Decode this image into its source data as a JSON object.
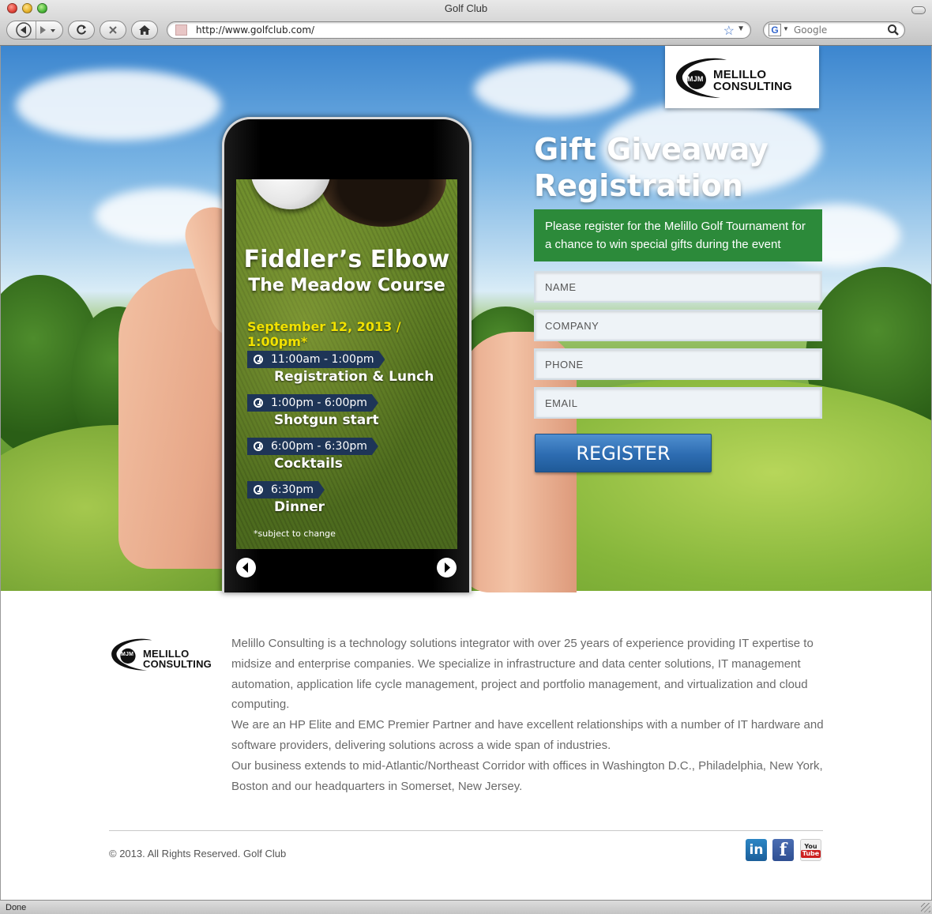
{
  "window": {
    "title": "Golf Club"
  },
  "toolbar": {
    "url": "http://www.golfclub.com/",
    "search_placeholder": "Google",
    "search_engine_letter": "G"
  },
  "phone_screen": {
    "title": "Fiddler’s Elbow",
    "subtitle": "The Meadow Course",
    "date": "September 12, 2013 / 1:00pm*",
    "schedule": [
      {
        "time": "11:00am - 1:00pm",
        "label": "Registration & Lunch"
      },
      {
        "time": "1:00pm - 6:00pm",
        "label": "Shotgun start"
      },
      {
        "time": "6:00pm - 6:30pm",
        "label": "Cocktails"
      },
      {
        "time": "6:30pm",
        "label": "Dinner"
      }
    ],
    "note": "*subject to change"
  },
  "logo": {
    "line1": "MELILLO",
    "line2": "CONSULTING",
    "mark": "MJM"
  },
  "registration": {
    "heading_line1": "Gift Giveaway",
    "heading_line2": "Registration",
    "intro": "Please register for the Melillo Golf Tournament for a chance to win special gifts during the event",
    "name_placeholder": "NAME",
    "company_placeholder": "COMPANY",
    "phone_placeholder": "PHONE",
    "email_placeholder": "EMAIL",
    "register_label": "REGISTER"
  },
  "about": {
    "paragraph1": "Melillo Consulting is a technology solutions integrator with over 25 years of experience providing IT expertise to midsize and enterprise companies. We specialize in infrastructure and data center solutions, IT management automation, application life cycle management, project and portfolio management, and virtualization and cloud computing.",
    "paragraph2": "We are an HP Elite and EMC Premier Partner and have excellent relationships with a number of IT hardware and software providers, delivering solutions across a wide span of industries.",
    "paragraph3": "Our business extends to mid-Atlantic/Northeast Corridor with offices in Washington D.C., Philadelphia, New York, Boston and our headquarters in Somerset, New Jersey."
  },
  "footer": {
    "copyright": "© 2013. All Rights Reserved. Golf Club",
    "linkedin_label": "in",
    "facebook_label": "f",
    "youtube_you": "You",
    "youtube_tube": "Tube"
  },
  "status": {
    "text": "Done"
  },
  "colors": {
    "accent_green": "#2c8a3a",
    "button_blue": "#2d6cb1",
    "schedule_navy": "#1e3557",
    "date_yellow": "#f2e200"
  },
  "icons": [
    "back-icon",
    "forward-icon",
    "reload-icon",
    "stop-icon",
    "home-icon",
    "bookmark-star-icon",
    "search-icon",
    "clock-icon",
    "prev-arrow-icon",
    "next-arrow-icon",
    "linkedin-icon",
    "facebook-icon",
    "youtube-icon"
  ]
}
